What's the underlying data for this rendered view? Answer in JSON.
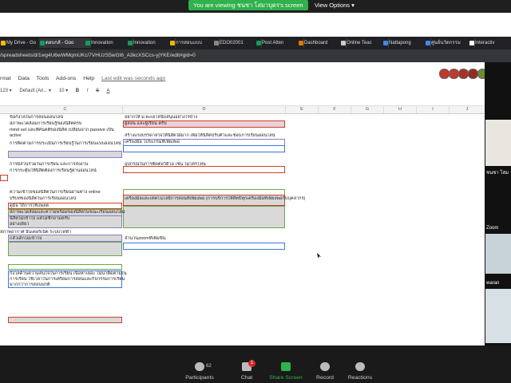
{
  "zoom": {
    "share_banner": "You are viewing ชนชา โสมาบุตร's screen",
    "view_options": "View Options ▾",
    "participants_count": "62",
    "chat_badge": "1",
    "bottom": [
      "Participants",
      "Chat",
      "Share Screen",
      "Record",
      "Reactions"
    ],
    "right_names": [
      "ชนชา โสม",
      "Zoom",
      "waran"
    ]
  },
  "browser": {
    "tabs": [
      "My Drive - Go",
      "ตอบกลั - Goo",
      "Innovation",
      "Innovation",
      "การสอนแบบ",
      "EDO02001",
      "Post Atten",
      "Dashboard",
      "Online Teac",
      "Nattapong",
      "ศูนย์นวัตกรรม",
      "Interactiv"
    ],
    "url": "/spreadsheets/d/1wg4U6wWMqmUKc/7VHUzS5wGt6_A3kcXSCcs-yjYKE/edit#gid=0"
  },
  "sheet": {
    "menu": [
      "rmat",
      "Data",
      "Tools",
      "Add-ons",
      "Help"
    ],
    "last_edit": "Last edit was seconds ago",
    "toolbar": [
      "123 ▾",
      "Default (Ari... ▾",
      "10 ▾",
      "B",
      "I",
      "S",
      "A"
    ],
    "columns": [
      "C",
      "D",
      "E",
      "F",
      "G",
      "H",
      "I",
      "J"
    ],
    "cells_c": [
      "ข้อกังวลในการสอนออนไลน์",
      "สภาพแวดล้อมการเรียนรู้ของนิสิตครบ",
      "mind set และทัศนคติของนิสิต เปลี่ยนจาก passive เป็น",
      "active",
      "การติดตามการประเมินการเรียนรู้ในการเรียนแบบออนไลน์",
      "การมีส่วนร่วมในการเรียน และการส่งงาน",
      "การกระตุ้นให้นิสิตต้องการเรียนรู้ผ่านออนไลน์",
      "ความเข้าใจของนิสิตในการเรียนผ่านทาง online",
      "บริบทของนิสิตในการเรียนออนไลน์",
      "ดูมือ วิถีการใช้แพลต",
      "สภาพแวดล้อมและความพร้อมของนิสิตในขณะเรียนออนไลน์",
      "นิสิตไม่เข้าใจ แต่ไม่ซักถามครับ",
      "อย่างเดียว",
      "สภาพอากาศ อินเตอร์เน็ต ระบบไฟฟ้า",
      "กลัวเด็กไม่เข้าใจ",
      "กังวลด้านความสนใจในการเรียน เนื้อหาเยอะ ไม่น่าติดตามใน",
      "การเรียน ใช้เวลาในการเตรียมการสอนและกิจกรรมการเรียน",
      "มากกว่าการสอนปกติ"
    ],
    "cells_d": [
      "อยากให้ ม.พะเยาสนับสนุนอย่างไรบ้าง",
      "ผู้สอน และผู้เรียน ครับ",
      "สร้างแรงบรรดาลใจให้นิสิตใฝ่มาก เพื่อให้นิสิตปรับตัวและชอบการเรียนออนไลน์",
      "เครื่องมือ โปรแกรมที่เพียงพอ",
      "อุปกรณ์ในการติดต่อวิดีโอ เช่น โมโครโฟน",
      "เครื่องมือและเทคโนโลยีการสอนที่เพียงพอ (การบริการให้สิทธิทุกเครื่องมือที่เพียงพอกับบุคลากร)",
      "จำนวนzoomที่เพิ่มขึ้น"
    ],
    "d_tail": "งานไม่ครบ",
    "colors": {
      "purple": "#8e7cc3",
      "red": "#cc4125",
      "green": "#6aa84f",
      "blue": "#3c78d8",
      "gray": "#d9d9d9"
    }
  }
}
